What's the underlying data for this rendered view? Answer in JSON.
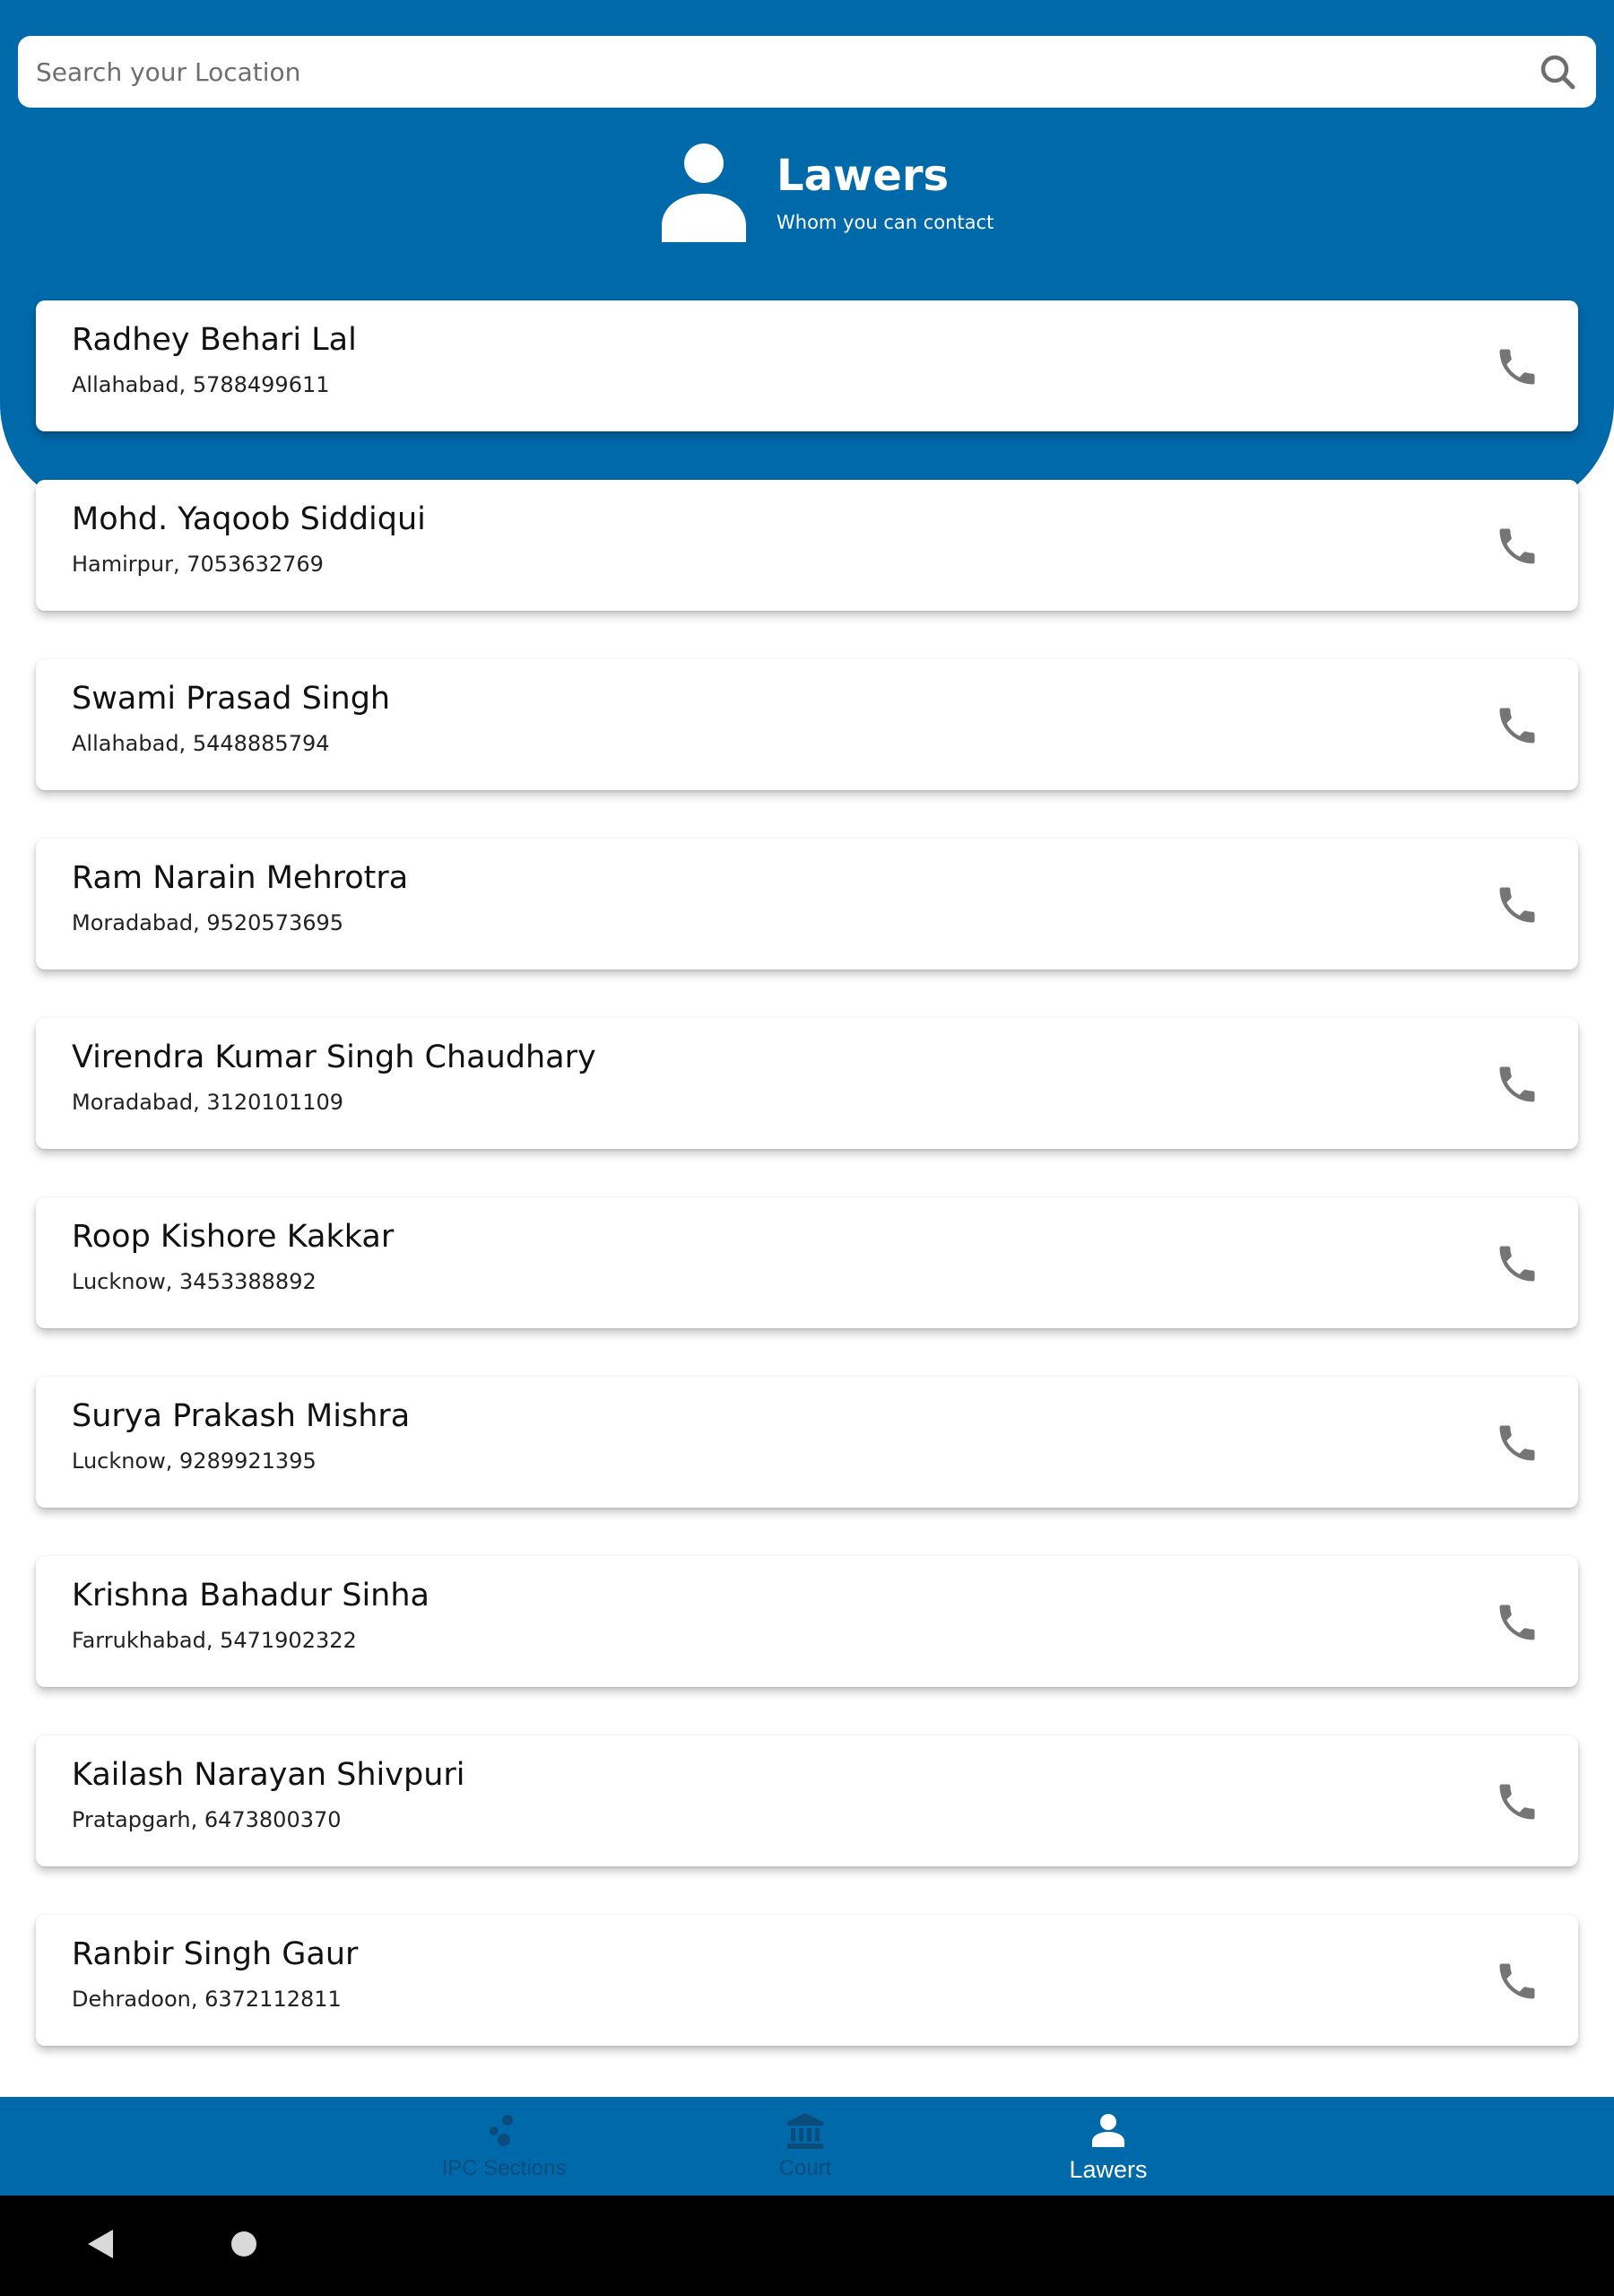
{
  "search": {
    "placeholder": "Search your Location",
    "value": "",
    "icon": "search-icon"
  },
  "header": {
    "icon": "person-icon",
    "title": "Lawers",
    "subtitle": "Whom you can contact"
  },
  "lawyers": [
    {
      "name": "Radhey Behari Lal",
      "detail": "Allahabad, 5788499611"
    },
    {
      "name": "Mohd. Yaqoob Siddiqui",
      "detail": "Hamirpur, 7053632769"
    },
    {
      "name": "Swami Prasad Singh",
      "detail": "Allahabad, 5448885794"
    },
    {
      "name": "Ram Narain Mehrotra",
      "detail": "Moradabad, 9520573695"
    },
    {
      "name": "Virendra Kumar Singh Chaudhary",
      "detail": "Moradabad, 3120101109"
    },
    {
      "name": "Roop Kishore Kakkar",
      "detail": "Lucknow, 3453388892"
    },
    {
      "name": "Surya Prakash Mishra",
      "detail": "Lucknow, 9289921395"
    },
    {
      "name": "Krishna Bahadur Sinha",
      "detail": "Farrukhabad, 5471902322"
    },
    {
      "name": "Kailash Narayan Shivpuri",
      "detail": "Pratapgarh, 6473800370"
    },
    {
      "name": "Ranbir Singh Gaur",
      "detail": "Dehradoon, 6372112811"
    }
  ],
  "card_icon": "phone-icon",
  "bottom_nav": {
    "items": [
      {
        "label": "IPC Sections",
        "icon": "scatter-dots-icon",
        "active": false
      },
      {
        "label": "Court",
        "icon": "bank-icon",
        "active": false
      },
      {
        "label": "Lawers",
        "icon": "person-icon",
        "active": true
      }
    ]
  },
  "system_nav": {
    "back_icon": "back-triangle-icon",
    "home_icon": "home-circle-icon"
  },
  "colors": {
    "primary": "#0069aa",
    "nav_inactive": "#0b4c7a",
    "icon_gray": "#757575",
    "system_bar": "#000000"
  }
}
